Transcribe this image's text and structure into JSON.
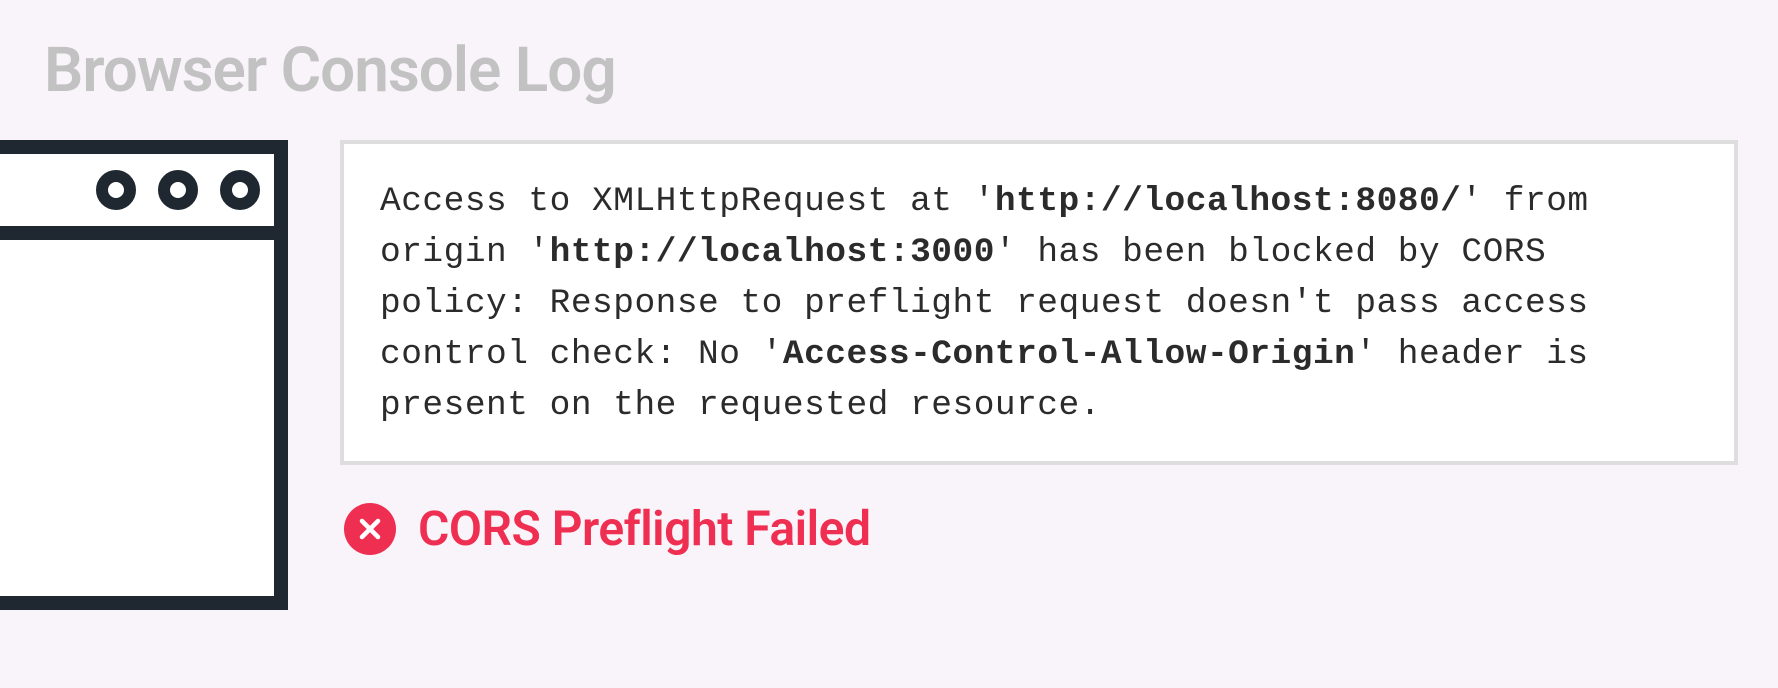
{
  "title": "Browser Console Log",
  "console": {
    "pre1": "Access to XMLHttpRequest at '",
    "bold_url1": "http://localhost:8080/",
    "mid1": "' from origin '",
    "bold_url2": "http://localhost:3000",
    "mid2": "' has been blocked by CORS policy: Response to preflight request doesn't pass access control check: No '",
    "bold_header": "Access-Control-Allow-Origin",
    "post": "' header is present on the requested resource."
  },
  "status": {
    "icon_name": "error-x-icon",
    "label": "CORS Preflight Failed"
  },
  "colors": {
    "bg": "#f9f4f9",
    "window_border": "#1f2830",
    "panel_border": "#dedede",
    "error": "#ef2f52",
    "title_muted": "#c2c2c3"
  }
}
